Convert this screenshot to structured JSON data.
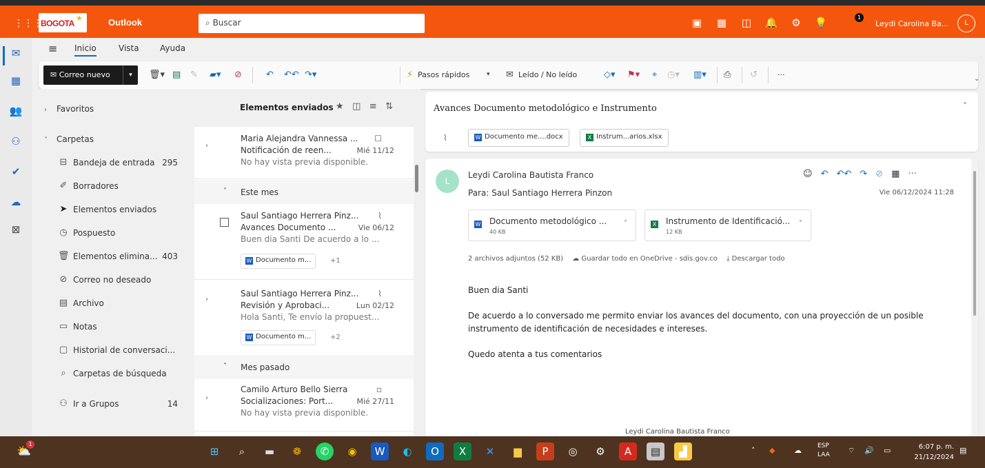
{
  "topbar": {
    "app_name": "Outlook",
    "logo_text": "BOGOTA",
    "search_placeholder": "Buscar",
    "user_name": "Leydi Carolina Ba...",
    "user_initial": "L",
    "notification_count": "1",
    "brand_color": "#f5560d"
  },
  "menu": {
    "items": [
      "Inicio",
      "Vista",
      "Ayuda"
    ]
  },
  "ribbon": {
    "new_mail": "Correo nuevo",
    "quick_steps": "Pasos rápidos",
    "read_unread": "Leído / No leído",
    "more": "···"
  },
  "folders": {
    "favorites": "Favoritos",
    "folders": "Carpetas",
    "items": [
      {
        "label": "Bandeja de entrada",
        "count": "295",
        "icon": "inbox-icon"
      },
      {
        "label": "Borradores",
        "count": "",
        "icon": "drafts-icon"
      },
      {
        "label": "Elementos enviados",
        "count": "",
        "icon": "sent-icon"
      },
      {
        "label": "Pospuesto",
        "count": "",
        "icon": "snooze-icon"
      },
      {
        "label": "Elementos elimina...",
        "count": "403",
        "icon": "trash-icon"
      },
      {
        "label": "Correo no deseado",
        "count": "",
        "icon": "junk-icon"
      },
      {
        "label": "Archivo",
        "count": "",
        "icon": "archive-icon"
      },
      {
        "label": "Notas",
        "count": "",
        "icon": "notes-icon"
      },
      {
        "label": "Historial de conversaci...",
        "count": "",
        "icon": "history-icon"
      },
      {
        "label": "Carpetas de búsqueda",
        "count": "",
        "icon": "search-folder-icon"
      }
    ],
    "groups": "Ir a Grupos",
    "groups_count": "14"
  },
  "list": {
    "title": "Elementos enviados",
    "group_this_month": "Este mes",
    "group_last_month": "Mes pasado",
    "messages": [
      {
        "sender": "Maria Alejandra Vannessa ...",
        "subject": "Notificación de reen...",
        "date": "Mié 11/12",
        "preview": "No hay vista previa disponible.",
        "attachment": "",
        "more": ""
      },
      {
        "sender": "Saul Santiago Herrera Pinz...",
        "subject": "Avances Documento ...",
        "date": "Vie 06/12",
        "preview": "Buen dia Santi De acuerdo a lo ...",
        "attachment": "Documento m...",
        "more": "+1"
      },
      {
        "sender": "Saul Santiago Herrera Pinz...",
        "subject": "Revisión y Aprobaci...",
        "date": "Lun 02/12",
        "preview": "Hola Santi, Te envío la propuest...",
        "attachment": "Documento m...",
        "more": "+2"
      },
      {
        "sender": "Camilo Arturo Bello Sierra",
        "subject": "Socializaciones: Port...",
        "date": "Mié 27/11",
        "preview": "No hay vista previa disponible.",
        "attachment": "",
        "more": ""
      }
    ]
  },
  "reading": {
    "subject": "Avances Documento metodológico e Instrumento",
    "chip1": "Documento me....docx",
    "chip2": "Instrum...arios.xlsx",
    "from": "Leydi Carolina Bautista Franco",
    "to": "Para: Saul Santiago Herrera Pinzon",
    "date": "Vie 06/12/2024 11:28",
    "att1_name": "Documento metodológico ...",
    "att1_size": "40 KB",
    "att2_name": "Instrumento de Identificació...",
    "att2_size": "12 KB",
    "att_summary": "2 archivos adjuntos (52 KB)",
    "save_onedrive": "Guardar todo en OneDrive - sdis.gov.co",
    "download_all": "Descargar todo",
    "greeting": "Buen dia Santi",
    "body": "De acuerdo a lo conversado me permito enviar los avances del documento, con una proyección de un posible instrumento de identificación de necesidades e intereses.",
    "closing": "Quedo atenta a tus comentarios",
    "signature": "Leydi Carolina Bautista Franco"
  },
  "taskbar": {
    "lang": "ESP",
    "lang2": "LAA",
    "time": "6:07 p. m.",
    "date": "21/12/2024",
    "weather_badge": "1"
  }
}
